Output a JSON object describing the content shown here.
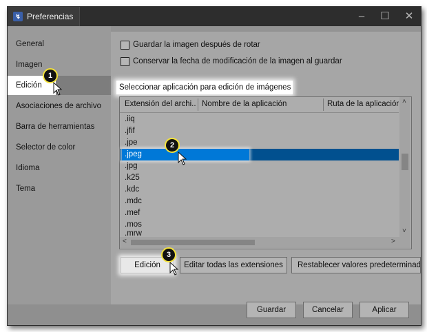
{
  "window": {
    "title": "Preferencias",
    "app_icon": "irfan-app-icon",
    "controls": [
      "minimize",
      "maximize",
      "close"
    ]
  },
  "sidebar": {
    "items": [
      {
        "label": "General"
      },
      {
        "label": "Imagen"
      },
      {
        "label": "Edición",
        "selected": true
      },
      {
        "label": "Asociaciones de archivo"
      },
      {
        "label": "Barra de herramientas"
      },
      {
        "label": "Selector de color"
      },
      {
        "label": "Idioma"
      },
      {
        "label": "Tema"
      }
    ]
  },
  "options": {
    "save_after_rotate": {
      "label": "Guardar la imagen después de rotar",
      "checked": false
    },
    "keep_mod_date": {
      "label": "Conservar la fecha de modificación de la imagen al guardar",
      "checked": false
    }
  },
  "editor_section": {
    "label": "Seleccionar aplicación para edición de imágenes",
    "columns": [
      "Extensión del archi...",
      "Nombre de la aplicación",
      "Ruta de la aplicación"
    ],
    "rows": [
      ".iiq",
      ".jfif",
      ".jpe",
      ".jpeg",
      ".jpg",
      ".k25",
      ".kdc",
      ".mdc",
      ".mef",
      ".mos",
      ".mrw"
    ],
    "selected_row": ".jpeg"
  },
  "action_buttons": {
    "edit": "Edición",
    "edit_all": "Editar todas las extensiones",
    "reset": "Restablecer valores predeterminados"
  },
  "footer": {
    "save": "Guardar",
    "cancel": "Cancelar",
    "apply": "Aplicar"
  },
  "callouts": [
    "1",
    "2",
    "3"
  ],
  "colors": {
    "selection": "#0078d7",
    "selection_dark": "#01508f",
    "badge_border": "#f4e23a"
  }
}
